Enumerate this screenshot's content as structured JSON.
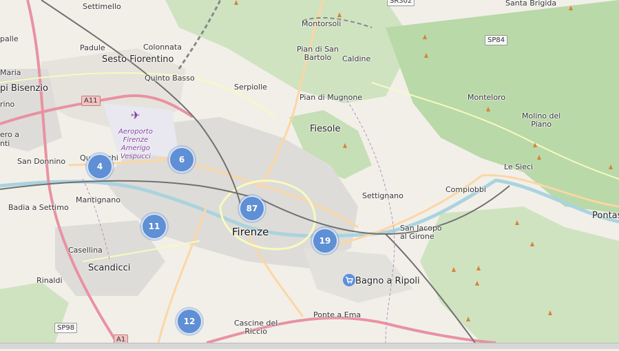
{
  "map": {
    "places": {
      "settimello": "Settimello",
      "padule": "Padule",
      "colonnata": "Colonnata",
      "sesto_fiorentino": "Sesto Fiorentino",
      "quinto_basso": "Quinto Basso",
      "serpiolle": "Serpiolle",
      "montorsoli": "Montorsoli",
      "pian_di_san_bartolo": "Pian di San\nBartolo",
      "caldine": "Caldine",
      "pian_di_mugnone": "Pian di Mugnone",
      "fiesole": "Fiesole",
      "monteloro": "Monteloro",
      "molino_del_piano": "Molino del\nPiano",
      "santa_brigida": "Santa Brigida",
      "le_sieci": "Le Sieci",
      "compiobbi": "Compiobbi",
      "settignano": "Settignano",
      "san_jacopo_al_girone": "San Jacopo\nal Girone",
      "pontassieve": "Pontas",
      "firenze": "Firenze",
      "bagno_a_ripoli": "Bagno a Ripoli",
      "ponte_a_ema": "Ponte a Ema",
      "cascine_del_riccio": "Cascine del\nRiccio",
      "scandicci": "Scandicci",
      "casellina": "Casellina",
      "rinaldi": "Rinaldi",
      "mantignano": "Mantignano",
      "badia_a_settimo": "Badia a Settimo",
      "san_donnino": "San Donnino",
      "quaracchi": "Quaracchi",
      "campi_bisenzio": "pi Bisenzio",
      "maria": "Maria",
      "palle": "palle",
      "rino": "rino",
      "ero_a": "ero a",
      "nti": "nti",
      "airport": "Aeroporto\nFirenze\nAmerigo\nVespucci"
    },
    "road_shields": {
      "a11": "A11",
      "sp84": "SP84",
      "sp98": "SP98",
      "a1": "A1",
      "sr302": "SR302"
    },
    "clusters": [
      {
        "count": "4"
      },
      {
        "count": "6"
      },
      {
        "count": "87"
      },
      {
        "count": "11"
      },
      {
        "count": "19"
      },
      {
        "count": "12"
      }
    ],
    "colors": {
      "land": "#f2efe9",
      "forest": "#add19e",
      "urban": "#dddddd",
      "water": "#aad3df",
      "motorway": "#e892a2",
      "primary": "#fcd6a4",
      "rail": "#707070",
      "cluster": "#5f8fd4"
    }
  }
}
